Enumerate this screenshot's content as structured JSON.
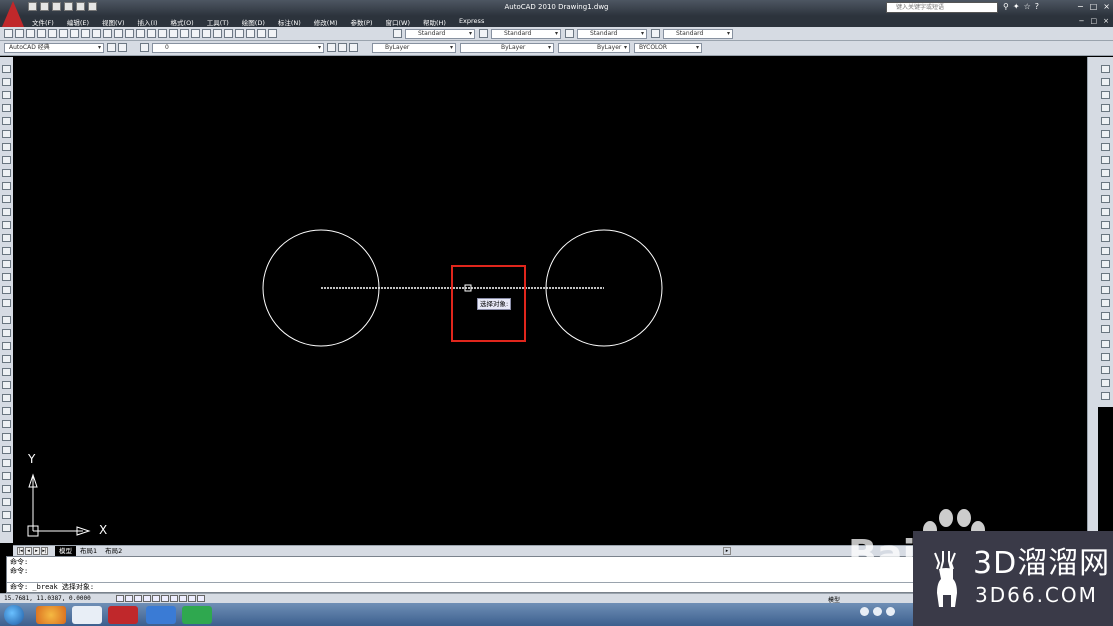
{
  "window": {
    "title": "AutoCAD 2010    Drawing1.dwg",
    "search_placeholder": "键入关键字或短语",
    "controls": [
      "−",
      "□",
      "×"
    ]
  },
  "menu": {
    "items": [
      "文件(F)",
      "编辑(E)",
      "视图(V)",
      "插入(I)",
      "格式(O)",
      "工具(T)",
      "绘图(D)",
      "标注(N)",
      "修改(M)",
      "参数(P)",
      "窗口(W)",
      "帮助(H)",
      "Express"
    ],
    "controls": [
      "−",
      "□",
      "×"
    ]
  },
  "toolbar1": {
    "text_style": "Standard",
    "dim_style": "Standard",
    "table_style": "Standard",
    "multileader_style": "Standard"
  },
  "toolbar2": {
    "workspace": "AutoCAD 经典",
    "layer": "0",
    "color": "ByLayer",
    "linetype": "ByLayer",
    "lineweight": "ByLayer",
    "plot_style": "BYCOLOR"
  },
  "canvas": {
    "tooltip": "选择对象:",
    "ucs_x": "X",
    "ucs_y": "Y"
  },
  "tabs": {
    "items": [
      "模型",
      "布局1",
      "布局2"
    ],
    "active": "模型"
  },
  "command": {
    "lines": [
      "命令:",
      "命令:",
      "命令: _break 选择对象:"
    ]
  },
  "status": {
    "coordinates": "15.7681, 11.0387, 0.0000",
    "model_label": "模型"
  },
  "watermark": {
    "brand": "3D溜溜网",
    "domain": "3D66.COM",
    "baidu": "Bai"
  },
  "colors": {
    "canvas": "#000000",
    "highlight": "#e0261c",
    "geometry": "#ffffff",
    "toolbar": "#d6dbe3"
  }
}
